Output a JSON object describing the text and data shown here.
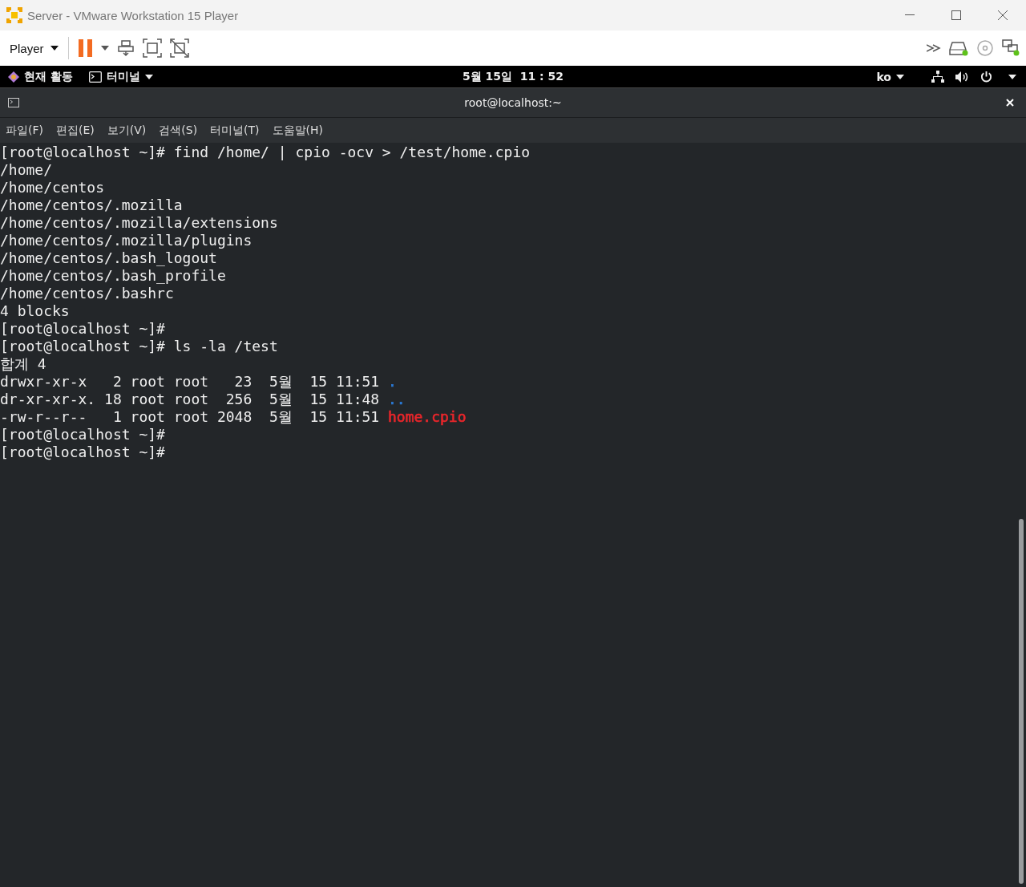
{
  "window": {
    "title": "Server - VMware Workstation 15 Player"
  },
  "toolbar": {
    "player_menu": "Player"
  },
  "top_bar": {
    "activities": "현재 활동",
    "app_menu": "터미널",
    "clock": "5월 15일  11 : 52",
    "input_method": "ko"
  },
  "terminal": {
    "title": "root@localhost:~",
    "menu": [
      "파일(F)",
      "편집(E)",
      "보기(V)",
      "검색(S)",
      "터미널(T)",
      "도움말(H)"
    ],
    "lines": [
      {
        "text": "[root@localhost ~]# find /home/ | cpio -ocv > /test/home.cpio"
      },
      {
        "text": "/home/"
      },
      {
        "text": "/home/centos"
      },
      {
        "text": "/home/centos/.mozilla"
      },
      {
        "text": "/home/centos/.mozilla/extensions"
      },
      {
        "text": "/home/centos/.mozilla/plugins"
      },
      {
        "text": "/home/centos/.bash_logout"
      },
      {
        "text": "/home/centos/.bash_profile"
      },
      {
        "text": "/home/centos/.bashrc"
      },
      {
        "text": "4 blocks"
      },
      {
        "text": "[root@localhost ~]#"
      },
      {
        "text": "[root@localhost ~]# ls -la /test"
      },
      {
        "text": "합계 4"
      },
      {
        "text": "drwxr-xr-x   2 root root   23  5월  15 11:51 ",
        "entry": {
          "text": ".",
          "color": "#2a7ad6"
        }
      },
      {
        "text": "dr-xr-xr-x. 18 root root  256  5월  15 11:48 ",
        "entry": {
          "text": "..",
          "color": "#2a7ad6"
        }
      },
      {
        "text": "-rw-r--r--   1 root root 2048  5월  15 11:51 ",
        "entry": {
          "text": "home.cpio",
          "color": "#e8262b"
        }
      },
      {
        "text": "[root@localhost ~]#"
      },
      {
        "text": "[root@localhost ~]#"
      }
    ]
  }
}
